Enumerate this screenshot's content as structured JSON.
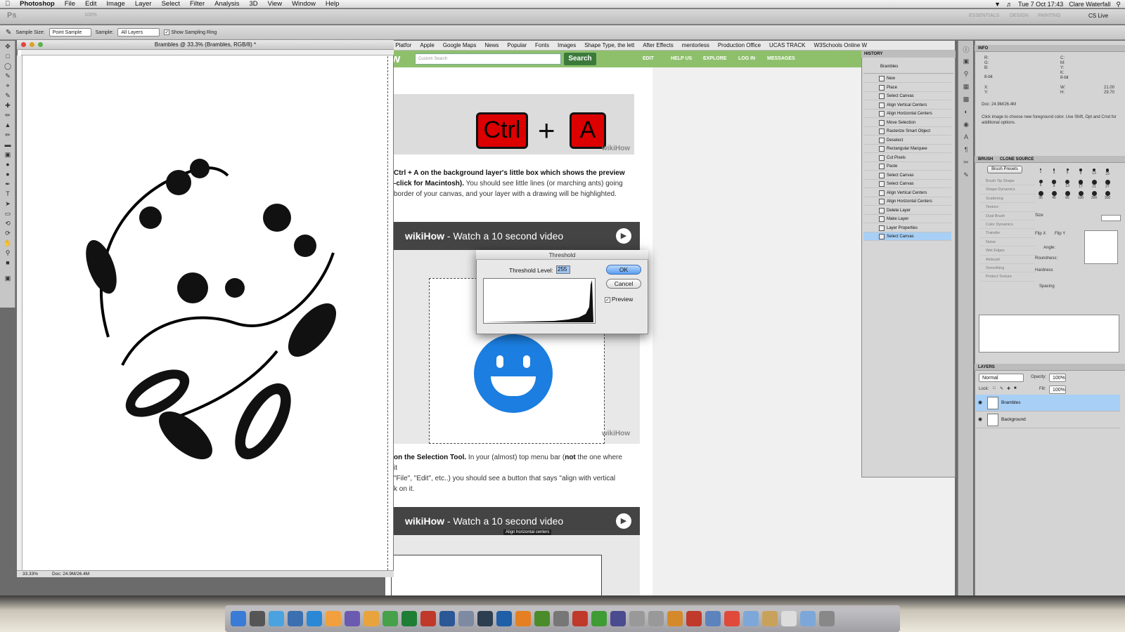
{
  "menubar": {
    "apple": "",
    "app": "Photoshop",
    "items": [
      "File",
      "Edit",
      "Image",
      "Layer",
      "Select",
      "Filter",
      "Analysis",
      "3D",
      "View",
      "Window",
      "Help"
    ],
    "clock": "Tue 7 Oct  17:43",
    "user": "Clare Waterfall"
  },
  "appbar": {
    "logo": "Ps",
    "zoom": "100%",
    "workspaces": [
      "ESSENTIALS",
      "DESIGN",
      "PAINTING"
    ],
    "cslive": "CS Live"
  },
  "options": {
    "sample_size_label": "Sample Size:",
    "sample_size_value": "Point Sample",
    "sample_label": "Sample:",
    "sample_value": "All Layers",
    "show_ring_label": "Show Sampling Ring"
  },
  "document": {
    "title": "Brambles @ 33.3% (Brambles, RGB/8) *",
    "zoom": "33.33%",
    "doc_size": "Doc: 24.9M/26.4M"
  },
  "browser": {
    "bookmarks": [
      "ss Platfor",
      "Apple",
      "Google Maps",
      "News",
      "Popular",
      "Fonts",
      "Images",
      "Shape Type, the lett",
      "After Effects",
      "mentorless",
      "Production Office",
      "UCAS TRACK",
      "W3Schools Online W"
    ],
    "search_placeholder": "Custom Search",
    "search_btn": "Search",
    "nav": [
      "EDIT",
      "HELP US",
      "EXPLORE",
      "LOG IN",
      "MESSAGES"
    ],
    "logo_partial": "w",
    "key1": "Ctrl",
    "key_plus": "+",
    "key2": "A",
    "watermark": "wikiHow",
    "para1_bold": "Ctrl + A on the background layer's little box which shows the preview",
    "para1_bold2": "-click for Macintosh).",
    "para1_rest": " You should see little lines (or marching ants) going",
    "para1_line3": "border of your canvas, and your layer with a drawing will be highlighted.",
    "video_brand": "wikiHow",
    "video_text": " - Watch a 10 second video",
    "para2_bold": "on the Selection Tool.",
    "para2_rest": " In your (almost) top menu bar (",
    "para2_not": "not",
    "para2_rest2": " the one where it",
    "para2_line2": "\"File\", \"Edit\", etc..) you should see a button that says \"align with vertical",
    "para2_line3": "k on it.",
    "tooltip": "Align horizontal centers"
  },
  "threshold": {
    "title": "Threshold",
    "label": "Threshold Level:",
    "value": "255",
    "ok": "OK",
    "cancel": "Cancel",
    "preview": "Preview"
  },
  "history": {
    "header": "HISTORY",
    "snapshot": "Brambles",
    "items": [
      "New",
      "Place",
      "Select Canvas",
      "Align Vertical Centers",
      "Align Horizontal Centers",
      "Move Selection",
      "Rasterize Smart Object",
      "Deselect",
      "Rectangular Marquee",
      "Cut Pixels",
      "Paste",
      "Select Canvas",
      "Select Canvas",
      "Align Vertical Centers",
      "Align Horizontal Centers",
      "Delete Layer",
      "Make Layer",
      "Layer Properties",
      "Select Canvas"
    ]
  },
  "info": {
    "header": "INFO",
    "rgb": [
      "R:",
      "G:",
      "B:"
    ],
    "cmyk": [
      "C:",
      "M:",
      "Y:",
      "K:"
    ],
    "bit1": "8-bit",
    "bit2": "8-bit",
    "xy": [
      "X:",
      "Y:"
    ],
    "wh": [
      "W:",
      "H:"
    ],
    "w": "21.00",
    "h": "29.70",
    "doc": "Doc: 24.9M/26.4M",
    "hint": "Click image to choose new foreground color.  Use Shift, Opt and Cmd for additional options."
  },
  "brush": {
    "tabs": [
      "BRUSH",
      "CLONE SOURCE"
    ],
    "presets_btn": "Brush Presets",
    "options": [
      "Brush Tip Shape",
      "Shape Dynamics",
      "Scattering",
      "Texture",
      "Dual Brush",
      "Color Dynamics",
      "Transfer",
      "Noise",
      "Wet Edges",
      "Airbrush",
      "Smoothing",
      "Protect Texture"
    ],
    "sizes": [
      "1",
      "3",
      "5",
      "9",
      "13",
      "19",
      "5",
      "9",
      "13",
      "17",
      "21",
      "27",
      "35",
      "45",
      "65",
      "100",
      "200",
      "300"
    ],
    "labels": [
      "Size",
      "Flip X",
      "Flip Y",
      "Angle:",
      "Roundness:",
      "Hardness",
      "Spacing"
    ]
  },
  "layers": {
    "header": "LAYERS",
    "blend": "Normal",
    "opacity_label": "Opacity:",
    "opacity": "100%",
    "lock_label": "Lock:",
    "fill_label": "Fill:",
    "fill": "100%",
    "items": [
      "Brambles",
      "Background"
    ]
  },
  "dock": [
    "Finder",
    "Dashboard",
    "App Store",
    "Safari",
    "iTunes",
    "Sparkle",
    "iMovie",
    "Pages",
    "Maps",
    "Excel",
    "PowerPoint",
    "Word",
    "Preview",
    "Lightroom",
    "Photoshop",
    "Illustrator",
    "Dreamweaver",
    "Utilities",
    "Acrobat",
    "Numbers",
    "After Effects",
    "?",
    "?",
    "Photos",
    "Calendar",
    "Keynote",
    "Chrome",
    "Folder",
    "Home",
    "Docs",
    "Folder",
    "Trash"
  ]
}
